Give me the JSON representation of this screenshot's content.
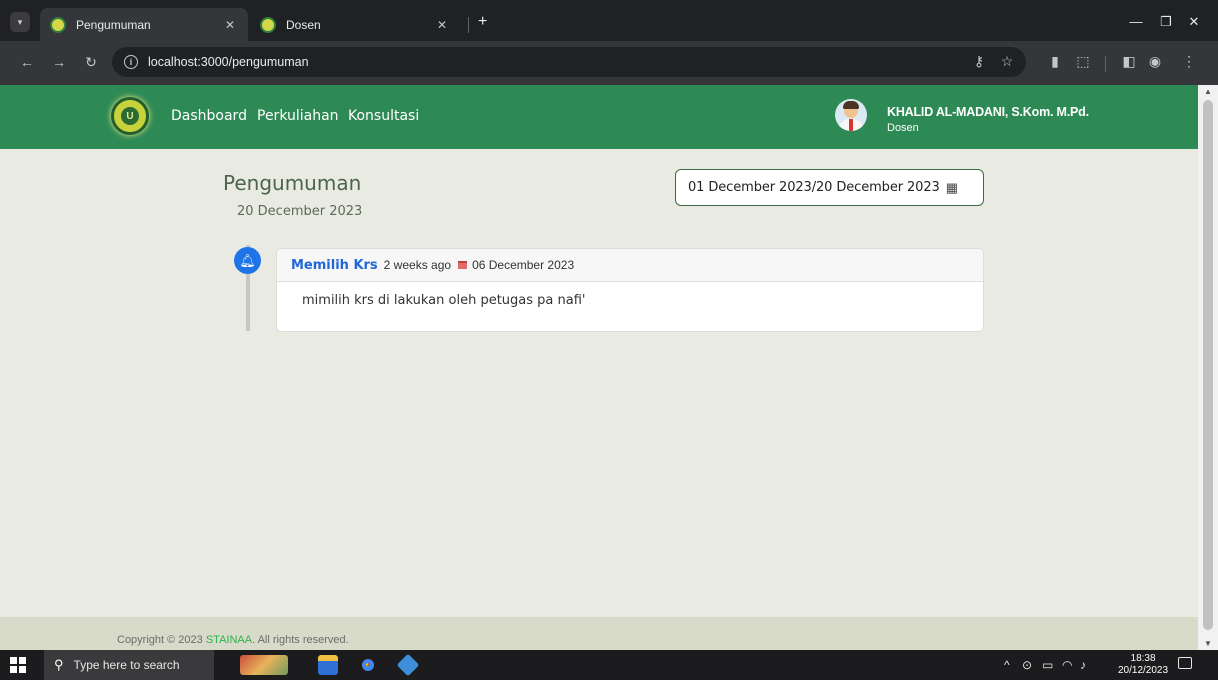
{
  "browser": {
    "tabs": [
      {
        "title": "Pengumuman",
        "active": true
      },
      {
        "title": "Dosen",
        "active": false
      }
    ],
    "url": "localhost:3000/pengumuman"
  },
  "navbar": {
    "links": [
      "Dashboard",
      "Perkuliahan",
      "Konsultasi"
    ],
    "user_name": "KHALID AL-MADANI, S.Kom. M.Pd.",
    "user_role": "Dosen"
  },
  "page": {
    "title": "Pengumuman",
    "date": "20 December 2023",
    "date_range": "01 December 2023/20 December 2023"
  },
  "announcement": {
    "title": "Memilih Krs",
    "ago": "2 weeks ago",
    "date": "06 December 2023",
    "body": "mimilih krs di lakukan oleh petugas pa nafi'"
  },
  "footer": {
    "prefix": "Copyright © 2023 ",
    "brand": "STAINAA",
    "suffix": ". All rights reserved."
  },
  "taskbar": {
    "search_placeholder": "Type here to search",
    "time": "18:38",
    "date": "20/12/2023"
  },
  "colors": {
    "navbar": "#2e8a55",
    "accent_blue": "#1f74e8",
    "brand_green": "#2cb34a"
  }
}
